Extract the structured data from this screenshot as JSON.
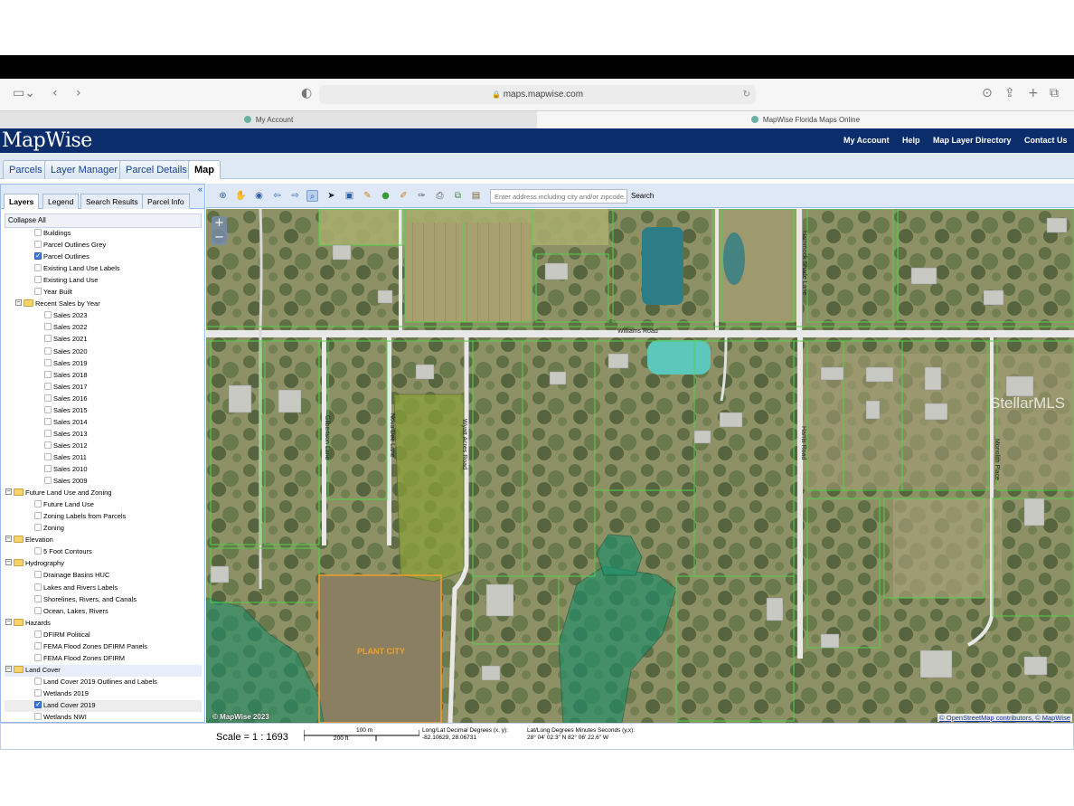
{
  "browser": {
    "url": "maps.mapwise.com",
    "tabs": [
      {
        "label": "My Account"
      },
      {
        "label": "MapWise Florida Maps Online"
      }
    ]
  },
  "header": {
    "logo": "MapWise",
    "links": [
      "My Account",
      "Help",
      "Map Layer Directory",
      "Contact Us"
    ]
  },
  "app_tabs": [
    "Parcels",
    "Layer Manager",
    "Parcel Details",
    "Map"
  ],
  "left_panel": {
    "tabs": [
      "Layers",
      "Legend",
      "Search Results",
      "Parcel Info"
    ],
    "collapse_all": "Collapse All",
    "tree": [
      {
        "label": "Buildings",
        "kind": "leaf",
        "checked": false
      },
      {
        "label": "Parcel Outlines Grey",
        "kind": "leaf",
        "checked": false
      },
      {
        "label": "Parcel Outlines",
        "kind": "leaf",
        "checked": true
      },
      {
        "label": "Existing Land Use Labels",
        "kind": "leaf",
        "checked": false
      },
      {
        "label": "Existing Land Use",
        "kind": "leaf",
        "checked": false
      },
      {
        "label": "Year Built",
        "kind": "leaf",
        "checked": false
      },
      {
        "label": "Recent Sales by Year",
        "kind": "folder",
        "checked": false
      },
      {
        "label": "Sales 2023",
        "kind": "subleaf",
        "checked": false
      },
      {
        "label": "Sales 2022",
        "kind": "subleaf",
        "checked": false
      },
      {
        "label": "Sales 2021",
        "kind": "subleaf",
        "checked": false
      },
      {
        "label": "Sales 2020",
        "kind": "subleaf",
        "checked": false
      },
      {
        "label": "Sales 2019",
        "kind": "subleaf",
        "checked": false
      },
      {
        "label": "Sales 2018",
        "kind": "subleaf",
        "checked": false
      },
      {
        "label": "Sales 2017",
        "kind": "subleaf",
        "checked": false
      },
      {
        "label": "Sales 2016",
        "kind": "subleaf",
        "checked": false
      },
      {
        "label": "Sales 2015",
        "kind": "subleaf",
        "checked": false
      },
      {
        "label": "Sales 2014",
        "kind": "subleaf",
        "checked": false
      },
      {
        "label": "Sales 2013",
        "kind": "subleaf",
        "checked": false
      },
      {
        "label": "Sales 2012",
        "kind": "subleaf",
        "checked": false
      },
      {
        "label": "Sales 2011",
        "kind": "subleaf",
        "checked": false
      },
      {
        "label": "Sales 2010",
        "kind": "subleaf",
        "checked": false
      },
      {
        "label": "Sales 2009",
        "kind": "subleaf",
        "checked": false
      },
      {
        "label": "Future Land Use and Zoning",
        "kind": "topfolder",
        "checked": false
      },
      {
        "label": "Future Land Use",
        "kind": "leaf",
        "checked": false
      },
      {
        "label": "Zoning Labels from Parcels",
        "kind": "leaf",
        "checked": false
      },
      {
        "label": "Zoning",
        "kind": "leaf",
        "checked": false
      },
      {
        "label": "Elevation",
        "kind": "topfolder",
        "checked": false
      },
      {
        "label": "5 Foot Contours",
        "kind": "leaf",
        "checked": false
      },
      {
        "label": "Hydrography",
        "kind": "topfolder",
        "checked": false
      },
      {
        "label": "Drainage Basins HUC",
        "kind": "leaf",
        "checked": false
      },
      {
        "label": "Lakes and Rivers Labels",
        "kind": "leaf",
        "checked": false
      },
      {
        "label": "Shorelines, Rivers, and Canals",
        "kind": "leaf",
        "checked": false
      },
      {
        "label": "Ocean, Lakes, Rivers",
        "kind": "leaf",
        "checked": false
      },
      {
        "label": "Hazards",
        "kind": "topfolder",
        "checked": false
      },
      {
        "label": "DFIRM Political",
        "kind": "leaf",
        "checked": false
      },
      {
        "label": "FEMA Flood Zones DFIRM Panels",
        "kind": "leaf",
        "checked": false
      },
      {
        "label": "FEMA Flood Zones DFIRM",
        "kind": "leaf",
        "checked": false
      },
      {
        "label": "Land Cover",
        "kind": "topfolder",
        "checked": false,
        "highlight": true
      },
      {
        "label": "Land Cover 2019 Outlines and Labels",
        "kind": "leaf",
        "checked": false
      },
      {
        "label": "Wetlands 2019",
        "kind": "leaf",
        "checked": false
      },
      {
        "label": "Land Cover 2019",
        "kind": "leaf",
        "checked": true,
        "selected": true
      },
      {
        "label": "Wetlands NWI",
        "kind": "leaf",
        "checked": false
      }
    ]
  },
  "toolbar": {
    "icons": [
      "zoom-in-tool-icon",
      "pan-hand-icon",
      "center-target-icon",
      "back-arrow-icon",
      "forward-arrow-icon",
      "zoom-box-icon",
      "select-pointer-icon",
      "identify-icon",
      "measure-icon",
      "globe-icon",
      "draw-icon",
      "edit-draw-icon",
      "print-icon",
      "export-icon",
      "image-icon"
    ],
    "search_placeholder": "Enter address including city and/or zipcode.",
    "search_label": "Search"
  },
  "map": {
    "road_labels": [
      "Williams Road",
      "Hammock Shade Lane",
      "Gilbertson Lane",
      "Nova Dee Lane",
      "Wyatt Acres Road",
      "Harris Road",
      "Monolith Place"
    ],
    "area_label": "PLANT CITY",
    "watermark": "StellarMLS",
    "copyright": "© MapWise 2023",
    "attribution_osm": "© OpenStreetMap contributors",
    "attribution_mw": "© MapWise",
    "zoom_in": "+",
    "zoom_out": "−"
  },
  "status": {
    "scale": "Scale = 1 : 1693",
    "scalebar_top": "100 m",
    "scalebar_bottom": "200 ft",
    "decimal_label": "Long/Lat Decimal Degrees (x, y):",
    "decimal_value": "-82.10629, 28.06731",
    "dms_label": "Lat/Long Degrees Minutes Seconds (y,x):",
    "dms_value": "28° 04' 02.3\" N 82° 06' 22.6\" W"
  },
  "colors": {
    "header_bg": "#0c2d6b",
    "tab_blue": "#dfe8f6",
    "parcel_line": "#53d14a",
    "wetland": "#1f8f6a",
    "selected_parcel": "#f0a030"
  }
}
